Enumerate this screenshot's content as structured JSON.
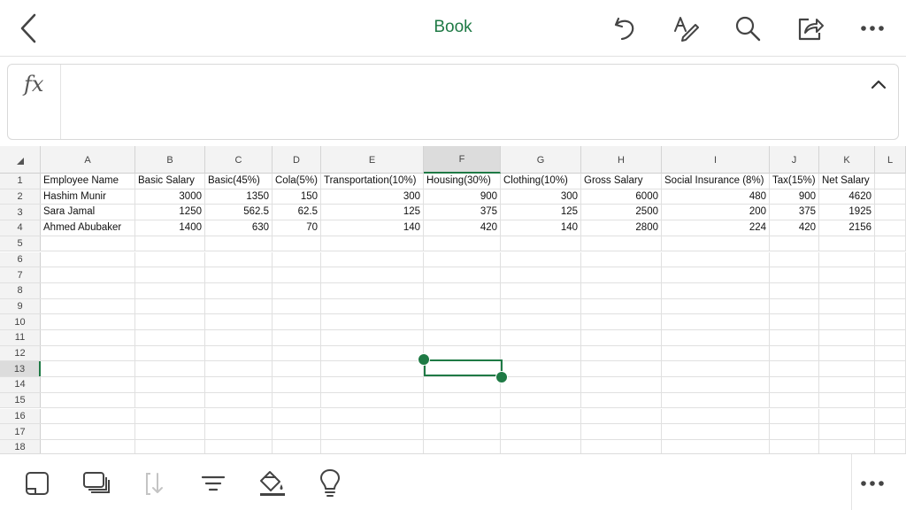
{
  "header": {
    "title": "Book",
    "icons": [
      "back-icon",
      "undo-icon",
      "text-edit-icon",
      "search-icon",
      "share-icon",
      "more-icon"
    ]
  },
  "formula_bar": {
    "fx_label": "fx",
    "value": ""
  },
  "grid": {
    "columns": [
      "A",
      "B",
      "C",
      "D",
      "E",
      "F",
      "G",
      "H",
      "I",
      "J",
      "K",
      "L"
    ],
    "selected_column": "F",
    "selected_row": "13",
    "row_numbers": [
      "1",
      "2",
      "3",
      "4",
      "5",
      "6",
      "7",
      "8",
      "9",
      "10",
      "11",
      "12",
      "13",
      "14",
      "15",
      "16",
      "17",
      "18"
    ],
    "headers": [
      "Employee Name",
      "Basic Salary",
      "Basic(45%)",
      "Cola(5%)",
      "Transportation(10%)",
      "Housing(30%)",
      "Clothing(10%)",
      "Gross Salary",
      "Social Insurance (8%)",
      "Tax(15%)",
      "Net Salary"
    ],
    "rows": [
      [
        "Hashim Munir",
        "3000",
        "1350",
        "150",
        "300",
        "900",
        "300",
        "6000",
        "480",
        "900",
        "4620"
      ],
      [
        "Sara Jamal",
        "1250",
        "562.5",
        "62.5",
        "125",
        "375",
        "125",
        "2500",
        "200",
        "375",
        "1925"
      ],
      [
        "Ahmed Abubaker",
        "1400",
        "630",
        "70",
        "140",
        "420",
        "140",
        "2800",
        "224",
        "420",
        "2156"
      ]
    ]
  },
  "bottom_toolbar": {
    "icons": [
      "sheet-icon",
      "sheets-stack-icon",
      "sort-icon",
      "filter-icon",
      "fill-color-icon",
      "ideas-lightbulb-icon",
      "more-icon"
    ]
  },
  "colors": {
    "accent": "#1f7a45",
    "gridline": "#e0e0e0",
    "header_bg": "#f3f3f3"
  }
}
